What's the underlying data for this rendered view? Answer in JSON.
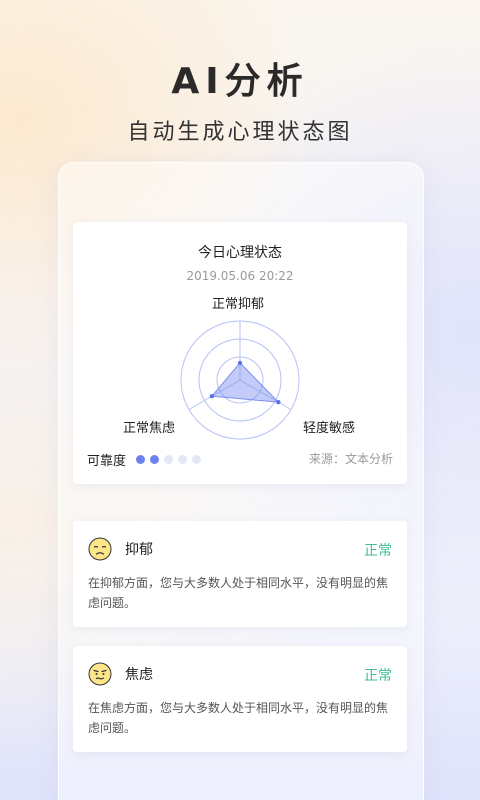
{
  "hero": {
    "title": "AI分析",
    "subtitle": "自动生成心理状态图"
  },
  "status_card": {
    "title": "今日心理状态",
    "datetime": "2019.05.06  20:22",
    "radar": {
      "axes": [
        "正常抑郁",
        "轻度敏感",
        "正常焦虑"
      ],
      "values": [
        0.29,
        0.75,
        0.55
      ],
      "fill_color": "#7b8ff0",
      "grid_color": "#b7c2f5"
    },
    "reliability_label": "可靠度",
    "reliability_score": 2,
    "reliability_max": 5,
    "source": "来源：文本分析"
  },
  "conditions": [
    {
      "name": "抑郁",
      "status": "正常",
      "description": "在抑郁方面，您与大多数人处于相同水平，没有明显的焦虑问题。",
      "icon": "sad-face-icon"
    },
    {
      "name": "焦虑",
      "status": "正常",
      "description": "在焦虑方面，您与大多数人处于相同水平，没有明显的焦虑问题。",
      "icon": "anxious-face-icon"
    }
  ],
  "colors": {
    "accent": "#6d82ec",
    "status_ok": "#3cbf91"
  }
}
